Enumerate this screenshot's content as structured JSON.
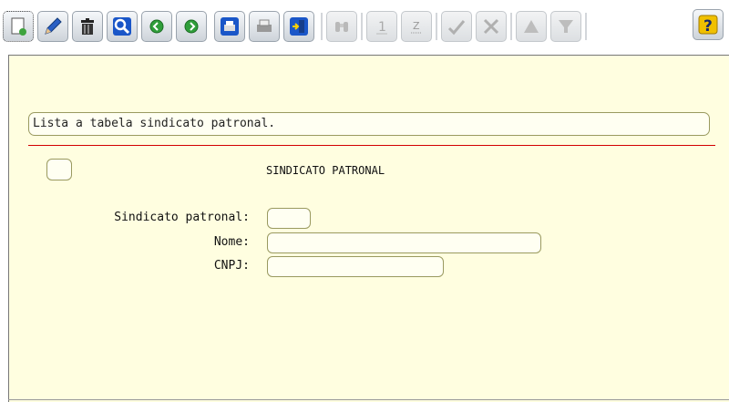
{
  "toolbar": {
    "buttons": [
      {
        "icon": "new-document-icon",
        "enabled": true
      },
      {
        "icon": "pencil-icon",
        "enabled": true
      },
      {
        "icon": "trash-icon",
        "enabled": true
      },
      {
        "icon": "search-icon",
        "enabled": true
      },
      {
        "icon": "arrow-left-circle-icon",
        "enabled": true
      },
      {
        "icon": "arrow-right-circle-icon",
        "enabled": true
      },
      {
        "icon": "printer-icon",
        "enabled": true
      },
      {
        "icon": "printer-gray-icon",
        "enabled": true
      },
      {
        "icon": "exit-door-icon",
        "enabled": true
      },
      {
        "icon": "binoculars-icon",
        "enabled": false
      },
      {
        "icon": "sort-numeric-icon",
        "enabled": false
      },
      {
        "icon": "sort-index-icon",
        "enabled": false
      },
      {
        "icon": "checkmark-icon",
        "enabled": false
      },
      {
        "icon": "tools-icon",
        "enabled": false
      },
      {
        "icon": "triangle-up-icon",
        "enabled": false
      },
      {
        "icon": "filter-icon",
        "enabled": false
      },
      {
        "icon": "help-icon",
        "enabled": true
      }
    ],
    "colors": {
      "accent_blue": "#1a56c8",
      "help_yellow": "#f0c000",
      "separator_red": "#d20000",
      "panel_bg": "#fffee0"
    }
  },
  "form": {
    "description": "Lista a tabela sindicato patronal.",
    "title": "SINDICATO PATRONAL",
    "fields": {
      "sindicato": {
        "label": "Sindicato patronal:",
        "value": ""
      },
      "nome": {
        "label": "Nome:",
        "value": ""
      },
      "cnpj": {
        "label": "CNPJ:",
        "value": ""
      }
    }
  }
}
